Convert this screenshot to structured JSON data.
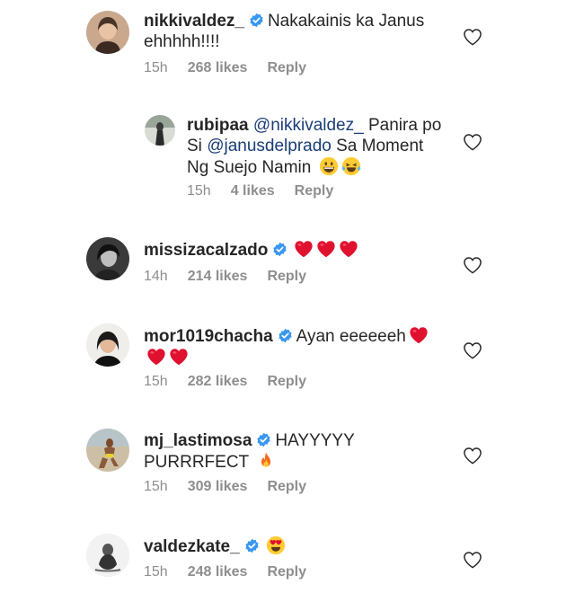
{
  "comments": [
    {
      "username": "nikkivaldez_",
      "text": "Nakakainis ka Janus ehhhhh!!!!",
      "time": "15h",
      "likes": "268 likes",
      "reply": "Reply"
    },
    {
      "username": "rubipaa",
      "mention1": "@nikkivaldez_",
      "text_a": " Panira po Si ",
      "mention2": "@janusdelprado",
      "text_b": " Sa Moment Ng Suejo Namin",
      "emojis": [
        "grinning-face",
        "face-with-tears-of-joy"
      ],
      "time": "15h",
      "likes": "4 likes",
      "reply": "Reply"
    },
    {
      "username": "missizacalzado",
      "emojis": [
        "red-heart",
        "red-heart",
        "red-heart"
      ],
      "time": "14h",
      "likes": "214 likes",
      "reply": "Reply"
    },
    {
      "username": "mor1019chacha",
      "text": "Ayan eeeeeeh",
      "emojis": [
        "red-heart",
        "red-heart",
        "red-heart"
      ],
      "time": "15h",
      "likes": "282 likes",
      "reply": "Reply"
    },
    {
      "username": "mj_lastimosa",
      "text": "HAYYYYY PURRRFECT",
      "emojis": [
        "fire"
      ],
      "time": "15h",
      "likes": "309 likes",
      "reply": "Reply"
    },
    {
      "username": "valdezkate_",
      "emojis": [
        "heart-eyes-face"
      ],
      "time": "15h",
      "likes": "248 likes",
      "reply": "Reply"
    }
  ],
  "colors": {
    "verified": "#3897f0",
    "mention": "#1a3d78",
    "meta": "#8e8e8e",
    "heart_emoji": "#e0102f"
  }
}
